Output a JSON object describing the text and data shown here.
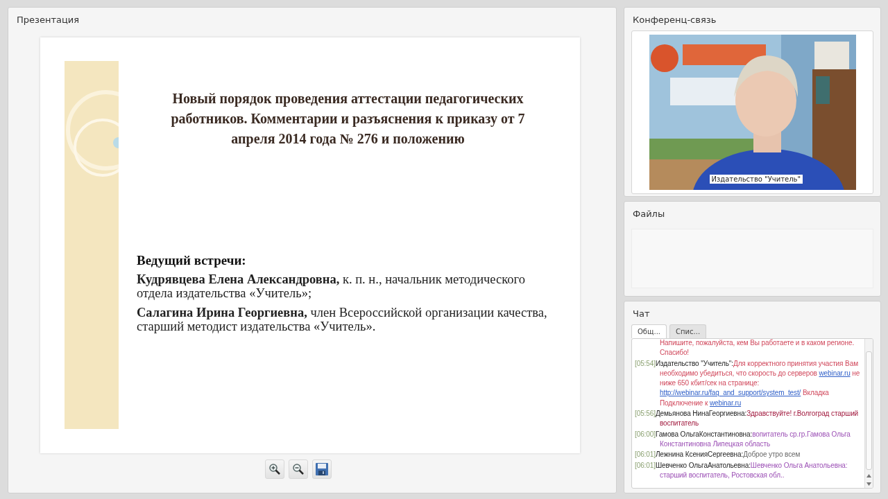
{
  "presentation": {
    "title": "Презентация",
    "slide": {
      "title": "Новый порядок проведения аттестации педагогических работников. Комментарии и разъяснения к приказу от 7 апреля 2014 года № 276 и положению",
      "host_heading": "Ведущий встречи:",
      "hosts": [
        "**Кудрявцева Елена Александровна,** к. п. н., начальник методического отдела издательства «Учитель»;",
        "**Салагина Ирина Георгиевна,** член Всероссийской организации качества, старший методист издательства «Учитель»."
      ]
    },
    "toolbar": [
      {
        "kind": "zoom_in"
      },
      {
        "kind": "zoom_out"
      },
      {
        "kind": "save"
      }
    ]
  },
  "conference": {
    "title": "Конференц-связь",
    "video": {
      "kind": "picture",
      "caption": "Издательство \"Учитель\""
    }
  },
  "files": {
    "title": "Файлы"
  },
  "chat": {
    "title": "Чат",
    "tabs": [
      {
        "label": "Общ...",
        "selected": true
      },
      {
        "label": "Спис...",
        "selected": false
      }
    ],
    "messages": [
      {
        "color": "#d0465a",
        "parts": [
          {
            "kind": "text",
            "text": "Напишите, пожалуйста, кем Вы работаете и в каком регионе. Спасибо!"
          }
        ]
      },
      {
        "time": "[05:54]",
        "author": "Издательство \"Учитель\":",
        "color": "#d0465a",
        "parts": [
          {
            "kind": "text",
            "text": "Для корректного принятия участия Вам необходимо убедиться, что скорость до серверов "
          },
          {
            "kind": "link",
            "text": "webinar.ru"
          },
          {
            "kind": "text",
            "text": " не ниже 650 кбит/сек на странице: "
          },
          {
            "kind": "link",
            "text": "http://webinar.ru/faq_and_support/system_test/"
          },
          {
            "kind": "text",
            "text": " Вкладка Подключение к "
          },
          {
            "kind": "link",
            "text": "webinar.ru"
          }
        ]
      },
      {
        "time": "[05:56]",
        "author": "Демьянова НинаГеоргиевна:",
        "color": "#a0173c",
        "parts": [
          {
            "kind": "text",
            "text": "Здравствуйте! г.Волгоград старший воспитатель"
          }
        ]
      },
      {
        "time": "[06:00]",
        "author": "Гамова ОльгаКонстантиновна:",
        "color": "#9b4fb5",
        "parts": [
          {
            "kind": "text",
            "text": "вопитатель ср.гр.Гамова Ольга Константиновна Липецкая область"
          }
        ]
      },
      {
        "time": "[06:01]",
        "author": "Лежнина КсенияСергеевна:",
        "color": "#666666",
        "parts": [
          {
            "kind": "text",
            "text": "Доброе утро всем"
          }
        ]
      },
      {
        "time": "[06:01]",
        "author": "Шевченко ОльгаАнатольевна:",
        "color": "#9b4fb5",
        "parts": [
          {
            "kind": "text",
            "text": "Шевченко Ольга Анатольевна: старший воспитатель, Ростовская обл.."
          }
        ]
      }
    ]
  }
}
